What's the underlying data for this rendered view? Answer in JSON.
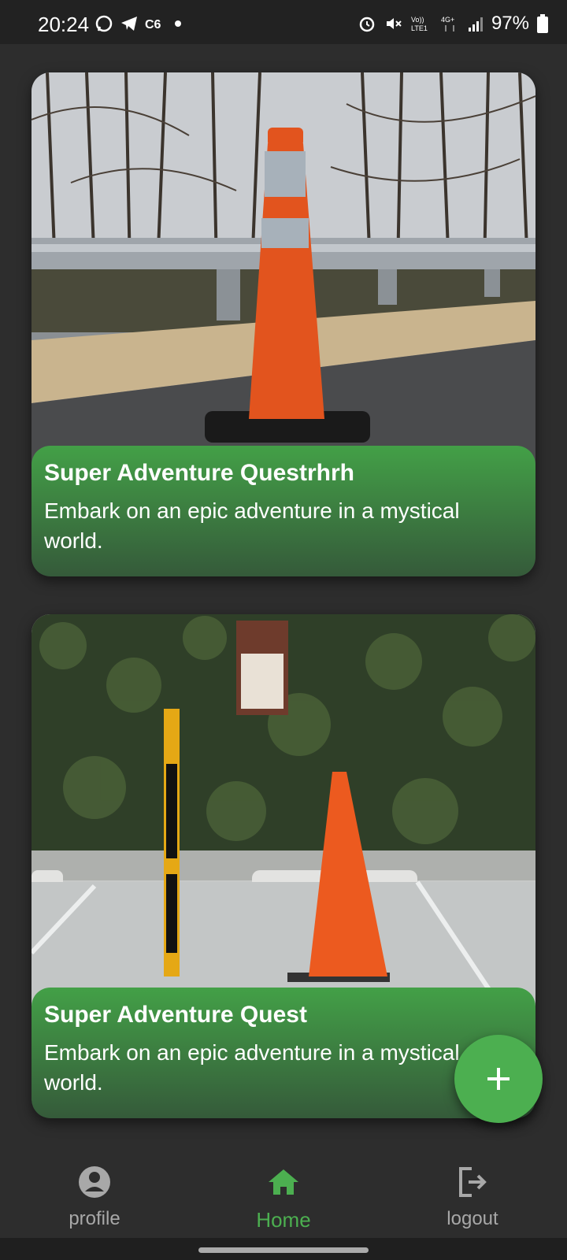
{
  "status_bar": {
    "time": "20:24",
    "battery": "97%",
    "left_icons": [
      "whatsapp-icon",
      "telegram-icon",
      "c6-icon"
    ],
    "right_icons": [
      "alarm-icon",
      "mute-icon",
      "volte-icon",
      "4g-icon",
      "signal-icon",
      "battery-icon"
    ],
    "network_label": "4G+"
  },
  "cards": [
    {
      "title": "Super Adventure Questrhrh",
      "description": "Embark on an epic adventure in a mystical world."
    },
    {
      "title": "Super Adventure Quest",
      "description": "Embark on an epic adventure in a mystical world."
    }
  ],
  "fab": {
    "icon": "plus-icon"
  },
  "nav": {
    "items": [
      {
        "label": "profile",
        "icon": "account-circle-icon"
      },
      {
        "label": "Home",
        "icon": "home-icon",
        "active": true
      },
      {
        "label": "logout",
        "icon": "logout-icon"
      }
    ]
  },
  "colors": {
    "accent": "#4caf50",
    "background": "#2d2d2d",
    "inactive_nav": "#a8a8a8"
  }
}
